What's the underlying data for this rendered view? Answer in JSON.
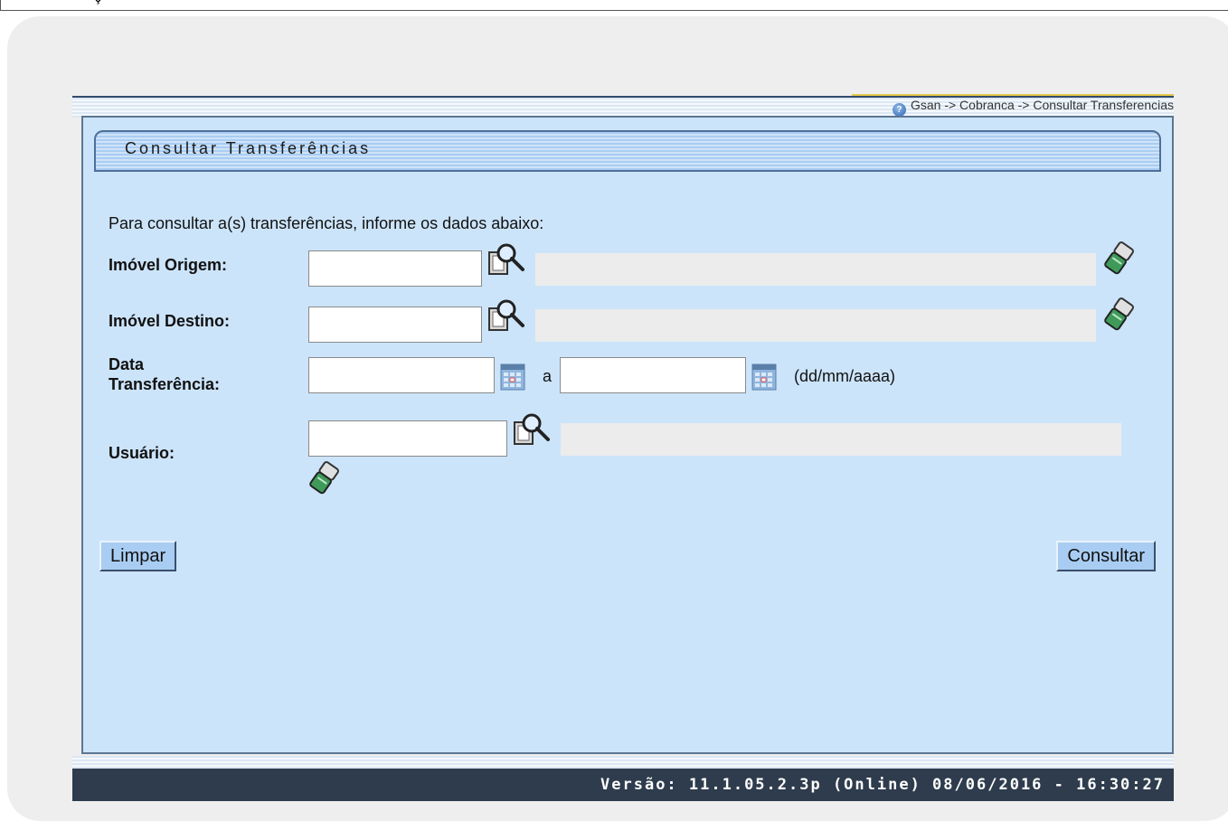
{
  "top_fragment": "ç",
  "breadcrumb": "Gsan -> Cobranca -> Consultar Transferencias",
  "title": "Consultar Transferências",
  "instructions": "Para consultar a(s) transferências, informe os dados abaixo:",
  "fields": {
    "imovel_origem": {
      "label": "Imóvel Origem:",
      "value": ""
    },
    "imovel_destino": {
      "label": "Imóvel Destino:",
      "value": ""
    },
    "data": {
      "label_line1": "Data",
      "label_line2": "Transferência:",
      "start": "",
      "separator": "a",
      "end": "",
      "format_hint": "(dd/mm/aaaa)"
    },
    "usuario": {
      "label": "Usuário:",
      "value": ""
    }
  },
  "buttons": {
    "limpar": "Limpar",
    "consultar": "Consultar"
  },
  "footer": "Versão: 11.1.05.2.3p (Online) 08/06/2016 - 16:30:27",
  "colors": {
    "panel": "#cce4fa",
    "footer": "#2e3c4d",
    "button": "#a9cdf2"
  }
}
